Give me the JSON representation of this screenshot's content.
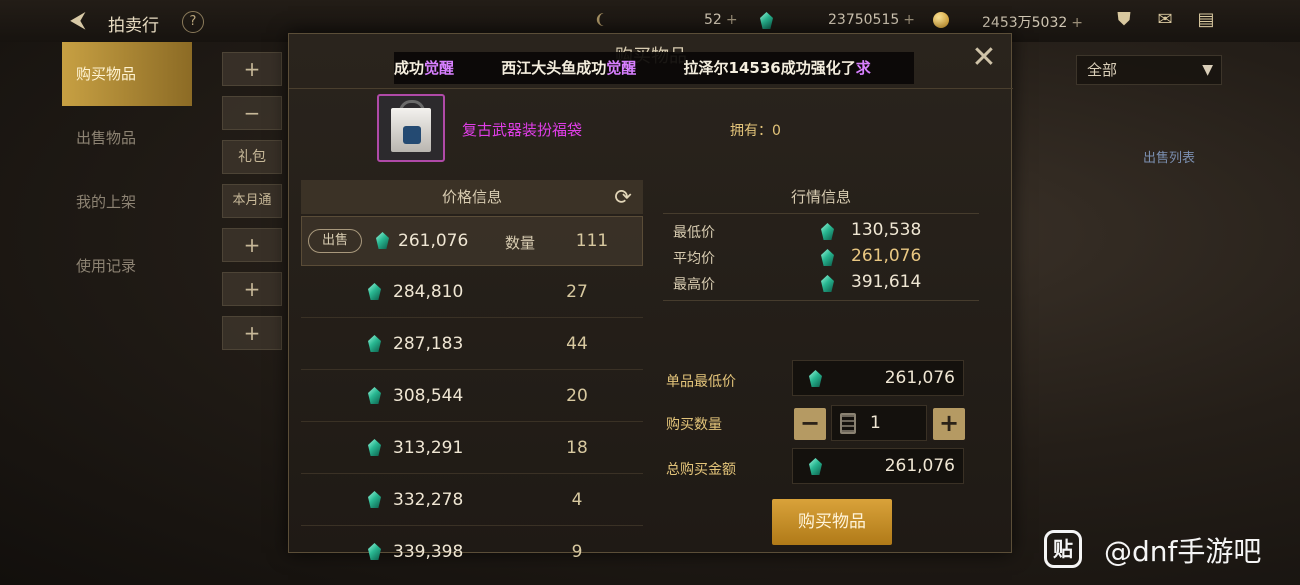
{
  "topbar": {
    "title": "拍卖行",
    "help": "?",
    "currencies": {
      "c1": "52",
      "c2": "2375051​5",
      "c3": "2453万5032"
    }
  },
  "sidebar": {
    "items": [
      "购买物品",
      "出售物品",
      "我的上架",
      "使用记录"
    ]
  },
  "left_filters": {
    "gift": "礼包",
    "month": "本月通"
  },
  "filter": {
    "selected": "全部"
  },
  "sell_list_link": "出售列表",
  "modal": {
    "title": "购买物品",
    "marquee": {
      "seg1_text": "成功",
      "seg1_hl": "觉醒",
      "seg2_text": "西江大头鱼成功",
      "seg2_hl": "觉醒",
      "seg3_text": "拉泽尔14536成功强化了",
      "seg3_hl": "求"
    },
    "item_name": "复古武器装扮福袋",
    "owned": "拥有：0",
    "price_panel_title": "价格信息",
    "sell_tag": "出售",
    "qty_label": "数量",
    "listings": [
      {
        "price": "261,076",
        "qty": "111"
      },
      {
        "price": "284,810",
        "qty": "27"
      },
      {
        "price": "287,183",
        "qty": "44"
      },
      {
        "price": "308,544",
        "qty": "20"
      },
      {
        "price": "313,291",
        "qty": "18"
      },
      {
        "price": "332,278",
        "qty": "4"
      },
      {
        "price": "339,398",
        "qty": "9"
      }
    ],
    "market": {
      "title": "行情信息",
      "min_label": "最低价",
      "min": "130,538",
      "avg_label": "平均价",
      "avg": "261,076",
      "max_label": "最高价",
      "max": "391,614"
    },
    "form": {
      "unit_min_label": "单品最低价",
      "unit_min": "261,076",
      "qty_label": "购买数量",
      "qty": "1",
      "total_label": "总购买金额",
      "total": "261,076"
    },
    "buy_button": "购买物品"
  },
  "watermark": {
    "icon": "贴",
    "text": "@dnf手游吧"
  },
  "colors": {
    "accent": "#c7a043",
    "item_rarity": "#e03ee8",
    "gem": "#29b892"
  }
}
